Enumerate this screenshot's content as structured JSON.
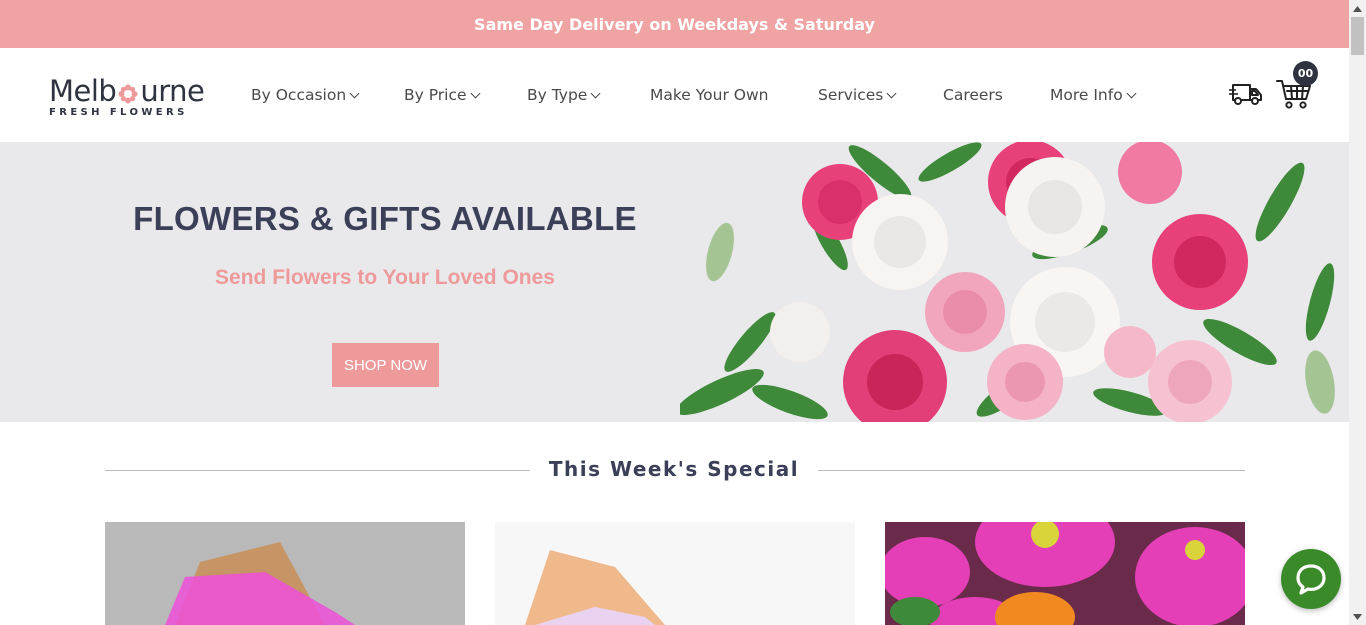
{
  "announcement": {
    "text": "Same Day Delivery on Weekdays & Saturday"
  },
  "logo": {
    "main_left": "Melb",
    "main_right": "urne",
    "sub": "FRESH FLOWERS"
  },
  "nav": {
    "items": [
      {
        "label": "By Occasion",
        "dropdown": true
      },
      {
        "label": "By Price",
        "dropdown": true
      },
      {
        "label": "By Type",
        "dropdown": true
      },
      {
        "label": "Make Your Own",
        "dropdown": false
      },
      {
        "label": "Services",
        "dropdown": true
      },
      {
        "label": "Careers",
        "dropdown": false
      },
      {
        "label": "More Info",
        "dropdown": true
      }
    ]
  },
  "header_icons": {
    "delivery": "delivery-truck-icon",
    "cart": "shopping-cart-icon",
    "cart_count": "00"
  },
  "hero": {
    "title": "FLOWERS & GIFTS AVAILABLE",
    "subtitle": "Send Flowers to Your Loved Ones",
    "cta_label": "SHOP NOW"
  },
  "section": {
    "title": "This Week's Special"
  },
  "colors": {
    "accent_pink": "#ef9a9a",
    "announce_bg": "#f0a3a3",
    "navy": "#3b3f58",
    "chat_green": "#3a8a2a"
  },
  "chat": {
    "icon": "chat-bubble-icon"
  }
}
